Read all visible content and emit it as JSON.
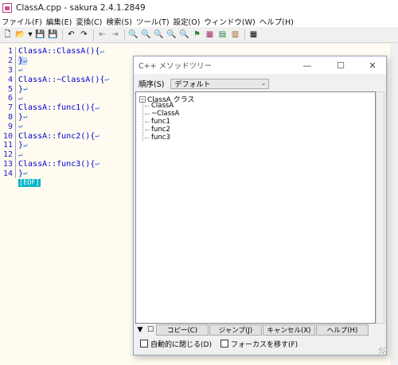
{
  "window": {
    "title": "ClassA.cpp - sakura 2.4.1.2849"
  },
  "menu": [
    "ファイル(F)",
    "編集(E)",
    "変換(C)",
    "検索(S)",
    "ツール(T)",
    "設定(O)",
    "ウィンドウ(W)",
    "ヘルプ(H)"
  ],
  "toolbar": {
    "icons": [
      "new-file-icon",
      "open-folder-icon",
      "dropdown-icon",
      "save-icon",
      "save-all-icon",
      "undo-icon",
      "redo-icon",
      "back-icon",
      "forward-icon",
      "search-prev-icon",
      "search-next-icon",
      "grep-icon",
      "replace-icon",
      "compare-icon",
      "jump-icon",
      "outline-icon",
      "settings-icon",
      "tools-icon",
      "window-list-icon"
    ],
    "glyphs": [
      "🗋",
      "📂",
      "▾",
      "💾",
      "💾",
      "↶",
      "↷",
      "⇤",
      "⇥",
      "🔍",
      "🔍",
      "🔍",
      "🔍",
      "🔍",
      "⚑",
      "▦",
      "▤",
      "▥",
      "▦"
    ]
  },
  "editor": {
    "lines": [
      {
        "num": "1",
        "text": "ClassA::ClassA(){"
      },
      {
        "num": "2",
        "text": "}"
      },
      {
        "num": "3",
        "text": ""
      },
      {
        "num": "4",
        "text": "ClassA::~ClassA(){"
      },
      {
        "num": "5",
        "text": "}"
      },
      {
        "num": "6",
        "text": ""
      },
      {
        "num": "7",
        "text": "ClassA::func1(){"
      },
      {
        "num": "8",
        "text": "}"
      },
      {
        "num": "9",
        "text": ""
      },
      {
        "num": "10",
        "text": "ClassA::func2(){"
      },
      {
        "num": "11",
        "text": "}"
      },
      {
        "num": "12",
        "text": ""
      },
      {
        "num": "13",
        "text": "ClassA::func3(){"
      },
      {
        "num": "14",
        "text": "}"
      }
    ],
    "newline_mark": "↵",
    "eof_mark": "[EOF]"
  },
  "dialog": {
    "title": "C++ メソッドツリー",
    "order_label": "順序(S)",
    "order_value": "デフォルト",
    "tree": {
      "root": "ClassA クラス",
      "expander": "−",
      "children": [
        "ClassA",
        "~ClassA",
        "func1",
        "func2",
        "func3"
      ]
    },
    "buttons": {
      "arrow": "▼",
      "square": "☐",
      "copy": "コピー(C)",
      "jump": "ジャンプ(J)",
      "cancel": "キャンセル(X)",
      "help": "ヘルプ(H)"
    },
    "checkboxes": {
      "auto_close": "自動的に閉じる(D)",
      "move_focus": "フォーカスを移す(F)"
    },
    "controls": {
      "minimize": "—",
      "maximize": "☐",
      "close": "✕"
    }
  }
}
